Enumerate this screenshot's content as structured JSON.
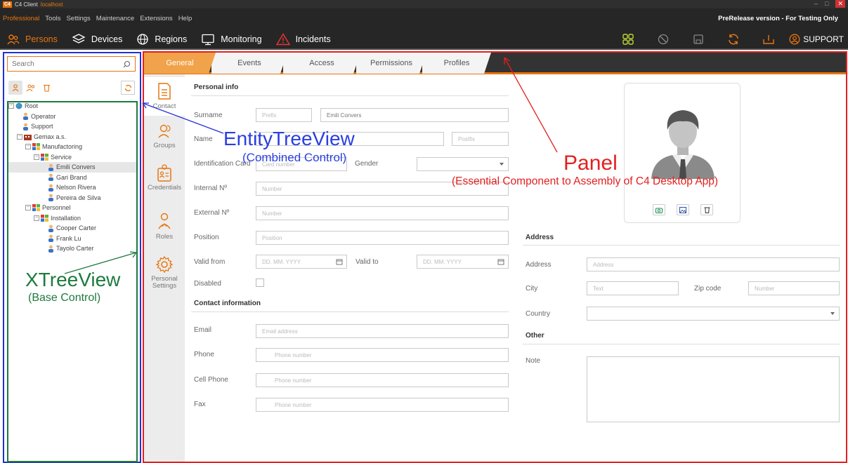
{
  "titlebar": {
    "app": "C4 Client",
    "host": "localhost",
    "logo": "C4"
  },
  "menu": {
    "items": [
      "Professional",
      "Tools",
      "Settings",
      "Maintenance",
      "Extensions",
      "Help"
    ],
    "prerelease": "PreRelease version - For Testing Only"
  },
  "toolbar": {
    "persons": "Persons",
    "devices": "Devices",
    "regions": "Regions",
    "monitoring": "Monitoring",
    "incidents": "Incidents",
    "support": "SUPPORT"
  },
  "search": {
    "placeholder": "Search"
  },
  "tree": [
    {
      "label": "Root"
    },
    {
      "label": "Operator"
    },
    {
      "label": "Support"
    },
    {
      "label": "Gemax a.s."
    },
    {
      "label": "Manufactoring"
    },
    {
      "label": "Service"
    },
    {
      "label": "Emili Convers"
    },
    {
      "label": "Gari Brand"
    },
    {
      "label": "Nelson Rivera"
    },
    {
      "label": "Pereira de Silva"
    },
    {
      "label": "Personnel"
    },
    {
      "label": "Installation"
    },
    {
      "label": "Cooper Carter"
    },
    {
      "label": "Frank Lu"
    },
    {
      "label": "Tayolo Carter"
    }
  ],
  "tabs": [
    "General",
    "Events",
    "Access",
    "Permissions",
    "Profiles"
  ],
  "sidenav": [
    "Contact",
    "Groups",
    "Credentials",
    "Roles",
    "Personal Settings"
  ],
  "form": {
    "personal_info": "Personal info",
    "surname": "Surname",
    "prefix_ph": "Prefix",
    "surname_value": "Emili Convers",
    "name": "Name",
    "postfix_ph": "Postfix",
    "id_card": "Identification Card",
    "card_ph": "Card number",
    "gender": "Gender",
    "internal": "Internal Nº",
    "external": "External Nº",
    "number_ph": "Number",
    "position": "Position",
    "position_ph": "Position",
    "valid_from": "Valid from",
    "valid_to": "Valid to",
    "date_ph": "DD. MM. YYYY",
    "disabled": "Disabled",
    "contact_info": "Contact information",
    "email": "Email",
    "email_ph": "Email address",
    "phone": "Phone",
    "phone_ph": "Phone number",
    "cell": "Cell Phone",
    "fax": "Fax"
  },
  "address": {
    "title": "Address",
    "address": "Address",
    "address_ph": "Address",
    "city": "City",
    "city_ph": "Text",
    "zip": "Zip code",
    "zip_ph": "Number",
    "country": "Country",
    "other": "Other",
    "note": "Note"
  },
  "annotations": {
    "entity": "EntityTreeView",
    "entity_sub": "(Combined Control)",
    "xtree": "XTreeView",
    "xtree_sub": "(Base Control)",
    "panel": "Panel",
    "panel_sub": "(Essential Component to Assembly of C4 Desktop App)"
  },
  "colors": {
    "accent": "#e8750f",
    "blue": "#2230d8",
    "green": "#1d7a3e",
    "red": "#e32020"
  }
}
